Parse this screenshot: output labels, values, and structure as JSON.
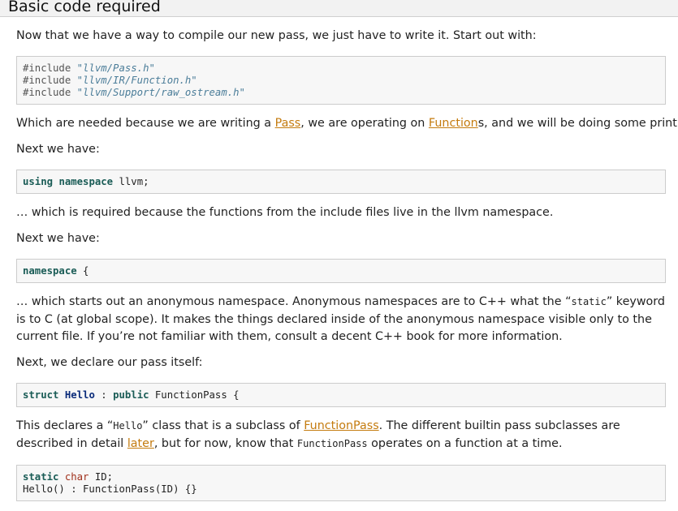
{
  "section": {
    "title": "Basic code required"
  },
  "paragraphs": {
    "intro": "Now that we have a way to compile our new pass, we just have to write it. Start out with:",
    "includes_why_a": "Which are needed because we are writing a ",
    "includes_why_link1": "Pass",
    "includes_why_b": ", we are operating on ",
    "includes_why_link2": "Function",
    "includes_why_c": "s, and we will be doing some printing.",
    "next1": "Next we have:",
    "namespace_why": "… which is required because the functions from the include files live in the llvm namespace.",
    "next2": "Next we have:",
    "anon_a": "… which starts out an anonymous namespace. Anonymous namespaces are to C++ what the “",
    "anon_code": "static",
    "anon_b": "” keyword is to C (at global scope). It makes the things declared inside of the anonymous namespace visible only to the current file. If you’re not familiar with them, consult a decent C++ book for more information.",
    "declare": "Next, we declare our pass itself:",
    "subclass_a": "This declares a “",
    "subclass_code1": "Hello",
    "subclass_b": "” class that is a subclass of ",
    "subclass_link1": "FunctionPass",
    "subclass_c": ". The different builtin pass subclasses are described in detail ",
    "subclass_link2": "later",
    "subclass_d": ", but for now, know that ",
    "subclass_code2": "FunctionPass",
    "subclass_e": " operates on a function at a time."
  },
  "code": {
    "includes": [
      {
        "directive": "#include",
        "path": "\"llvm/Pass.h\""
      },
      {
        "directive": "#include",
        "path": "\"llvm/IR/Function.h\""
      },
      {
        "directive": "#include",
        "path": "\"llvm/Support/raw_ostream.h\""
      }
    ],
    "using": {
      "kw1": "using",
      "kw2": "namespace",
      "rest": " llvm;"
    },
    "namespace": {
      "kw": "namespace",
      "rest": " {"
    },
    "struct": {
      "kw1": "struct",
      "name": "Hello",
      "sep": " : ",
      "kw2": "public",
      "rest": " FunctionPass {"
    },
    "last": {
      "line1_kw1": "static",
      "line1_kw2": "char",
      "line1_rest": " ID;",
      "line2": "Hello() : FunctionPass(ID) {}"
    }
  },
  "colors": {
    "link": "#c47b0e",
    "keyword": "#1a5c56",
    "class_name": "#0a2b7a",
    "type": "#a0301b",
    "string": "#4b7d99"
  }
}
